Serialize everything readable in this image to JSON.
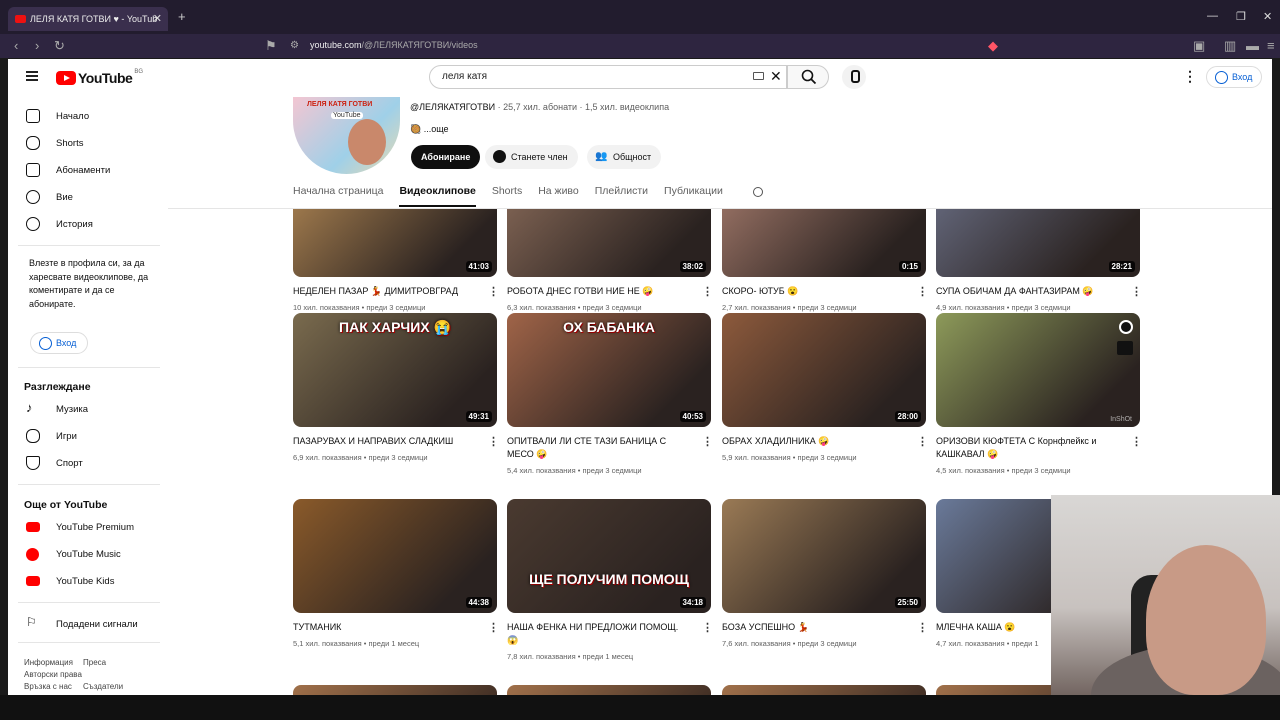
{
  "browser": {
    "tab_title": "ЛЕЛЯ КАТЯ ГОТВИ ♥ - YouTub",
    "url_host": "youtube.com",
    "url_path": "/@ЛЕЛЯКАТЯГОТВИ/videos"
  },
  "header": {
    "logo_text": "YouTube",
    "logo_country": "BG",
    "search_value": "леля катя",
    "signin_label": "Вход"
  },
  "sidebar": {
    "items": [
      {
        "label": "Начало",
        "icon": "home-icon"
      },
      {
        "label": "Shorts",
        "icon": "shorts-icon"
      },
      {
        "label": "Абонаменти",
        "icon": "subscriptions-icon"
      },
      {
        "label": "Вие",
        "icon": "you-icon"
      },
      {
        "label": "История",
        "icon": "history-icon"
      }
    ],
    "signin_prompt": "Влезте в профила си, за да харесвате видеоклипове, да коментирате и да се абонирате.",
    "signin_label": "Вход",
    "explore_title": "Разглеждане",
    "explore": [
      {
        "label": "Музика",
        "icon": "music-icon"
      },
      {
        "label": "Игри",
        "icon": "gaming-icon"
      },
      {
        "label": "Спорт",
        "icon": "trophy-icon"
      }
    ],
    "more_title": "Още от YouTube",
    "more": [
      {
        "label": "YouTube Premium"
      },
      {
        "label": "YouTube Music"
      },
      {
        "label": "YouTube Kids"
      }
    ],
    "report_label": "Подадени сигнали",
    "footer": [
      "Информация",
      "Преса",
      "Авторски права",
      "Връзка с нас",
      "Създатели"
    ]
  },
  "channel": {
    "avatar_text": "ЛЕЛЯ КАТЯ ГОТВИ",
    "avatar_sub": "YouTube",
    "handle": "@ЛЕЛЯКАТЯГОТВИ",
    "stats": " · 25,7 хил. абонати · 1,5 хил. видеоклипа",
    "more_label": "...още",
    "subscribe_label": "Абониране",
    "join_label": "Станете член",
    "community_label": "Общност",
    "tabs": [
      "Начална страница",
      "Видеоклипове",
      "Shorts",
      "На живо",
      "Плейлисти",
      "Публикации"
    ]
  },
  "videos": [
    {
      "title": "НЕДЕЛЕН ПАЗАР 💃 ДИМИТРОВГРАД",
      "views": "10 хил. показвания",
      "age": "преди 3 седмици",
      "duration": "41:03",
      "color": "#b58a55"
    },
    {
      "title": "РОБОТА ДНЕС ГОТВИ НИЕ НЕ 🤪",
      "views": "6,3 хил. показвания",
      "age": "преди 3 седмици",
      "duration": "38:02",
      "color": "#8c6d5b"
    },
    {
      "title": "СКОРО- ЮТУБ 😮",
      "views": "2,7 хил. показвания",
      "age": "преди 3 седмици",
      "duration": "0:15",
      "color": "#a87d6e"
    },
    {
      "title": "СУПА ОБИЧАМ ДА ФАНТАЗИРАМ 🤪",
      "views": "4,9 хил. показвания",
      "age": "преди 3 седмици",
      "duration": "28:21",
      "color": "#6c7188"
    },
    {
      "title": "ПАЗАРУВАХ И НАПРАВИХ СЛАДКИШ",
      "views": "6,9 хил. показвания",
      "age": "преди 3 седмици",
      "duration": "49:31",
      "overlay": "ПАК ХАРЧИХ 😭",
      "color": "#7a6b4e"
    },
    {
      "title": "ОПИТВАЛИ ЛИ СТЕ ТАЗИ БАНИЦА С МЕСО 🤪",
      "views": "5,4 хил. показвания",
      "age": "преди 3 седмици",
      "duration": "40:53",
      "overlay": "ОХ БАБАНКА",
      "color": "#a06448"
    },
    {
      "title": "ОБРАХ ХЛАДИЛНИКА 🤪",
      "views": "5,9 хил. показвания",
      "age": "преди 3 седмици",
      "duration": "28:00",
      "color": "#8d5a3c"
    },
    {
      "title": "ОРИЗОВИ КЮФТЕТА С Корнфлейкс и КАШКАВАЛ 🤪",
      "views": "4,5 хил. показвания",
      "age": "преди 3 седмици",
      "duration": "",
      "color": "#8d9a5a"
    },
    {
      "title": "ТУТМАНИК",
      "views": "5,1 хил. показвания",
      "age": "преди 1 месец",
      "duration": "44:38",
      "color": "#8a5a2a"
    },
    {
      "title": "НАША ФЕНКА НИ ПРЕДЛОЖИ ПОМОЩ. 😱",
      "views": "7,8 хил. показвания",
      "age": "преди 1 месец",
      "duration": "34:18",
      "overlay": "ЩЕ ПОЛУЧИМ ПОМОЩ",
      "color": "#4a3a30"
    },
    {
      "title": "БОЗА УСПЕШНО 💃",
      "views": "7,6 хил. показвания",
      "age": "преди 3 седмици",
      "duration": "25:50",
      "color": "#9a7a55"
    },
    {
      "title": "МЛЕЧНА КАША 😮",
      "views": "4,7 хил. показвания",
      "age": "преди 1",
      "duration": "",
      "color": "#6a7a9a"
    }
  ],
  "thumb_overlay_badge": "InShOt"
}
